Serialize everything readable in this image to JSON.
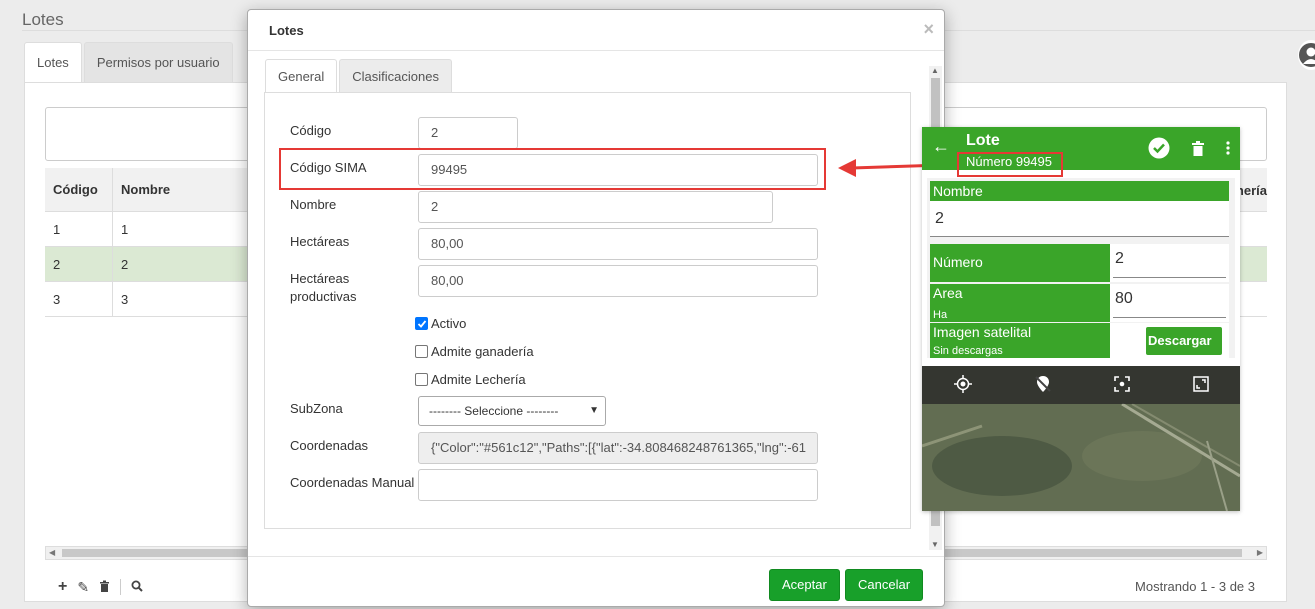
{
  "page": {
    "title": "Lotes",
    "tabs": [
      "Lotes",
      "Permisos por usuario"
    ],
    "table": {
      "headers": [
        "Código",
        "Nombre"
      ],
      "right_header": "nería",
      "rows": [
        [
          "1",
          "1"
        ],
        [
          "2",
          "2"
        ],
        [
          "3",
          "3"
        ]
      ]
    },
    "status": "Mostrando 1 - 3 de 3"
  },
  "modal": {
    "title": "Lotes",
    "close": "×",
    "tabs": [
      "General",
      "Clasificaciones"
    ],
    "fields": {
      "codigo": {
        "label": "Código",
        "value": "2"
      },
      "codigo_sima": {
        "label": "Código SIMA",
        "value": "99495"
      },
      "nombre": {
        "label": "Nombre",
        "value": "2"
      },
      "hectareas": {
        "label": "Hectáreas",
        "value": "80,00"
      },
      "hectareas_productivas": {
        "label": "Hectáreas productivas",
        "value": "80,00"
      },
      "activo": {
        "label": "Activo",
        "checked": true
      },
      "admite_ganaderia": {
        "label": "Admite ganadería",
        "checked": false
      },
      "admite_lecheria": {
        "label": "Admite Lechería",
        "checked": false
      },
      "subzona": {
        "label": "SubZona",
        "selected": "-------- Seleccione --------"
      },
      "coordenadas": {
        "label": "Coordenadas",
        "value": "{\"Color\":\"#561c12\",\"Paths\":[{\"lat\":-34.808468248761365,\"lng\":-61"
      },
      "coordenadas_manual": {
        "label": "Coordenadas Manual",
        "value": ""
      }
    },
    "buttons": {
      "accept": "Aceptar",
      "cancel": "Cancelar"
    }
  },
  "mobile": {
    "title": "Lote",
    "subtitle": "Número 99495",
    "nombre_label": "Nombre",
    "nombre_value": "2",
    "numero_label": "Número",
    "numero_value": "2",
    "area_label": "Area",
    "area_unit": "Ha",
    "area_value": "80",
    "imagen_label": "Imagen satelital",
    "imagen_status": "Sin descargas",
    "download_label": "Descargar"
  },
  "colors": {
    "accent_green": "#3aa529",
    "button_green": "#18a02a",
    "highlight_red": "#e53935"
  }
}
